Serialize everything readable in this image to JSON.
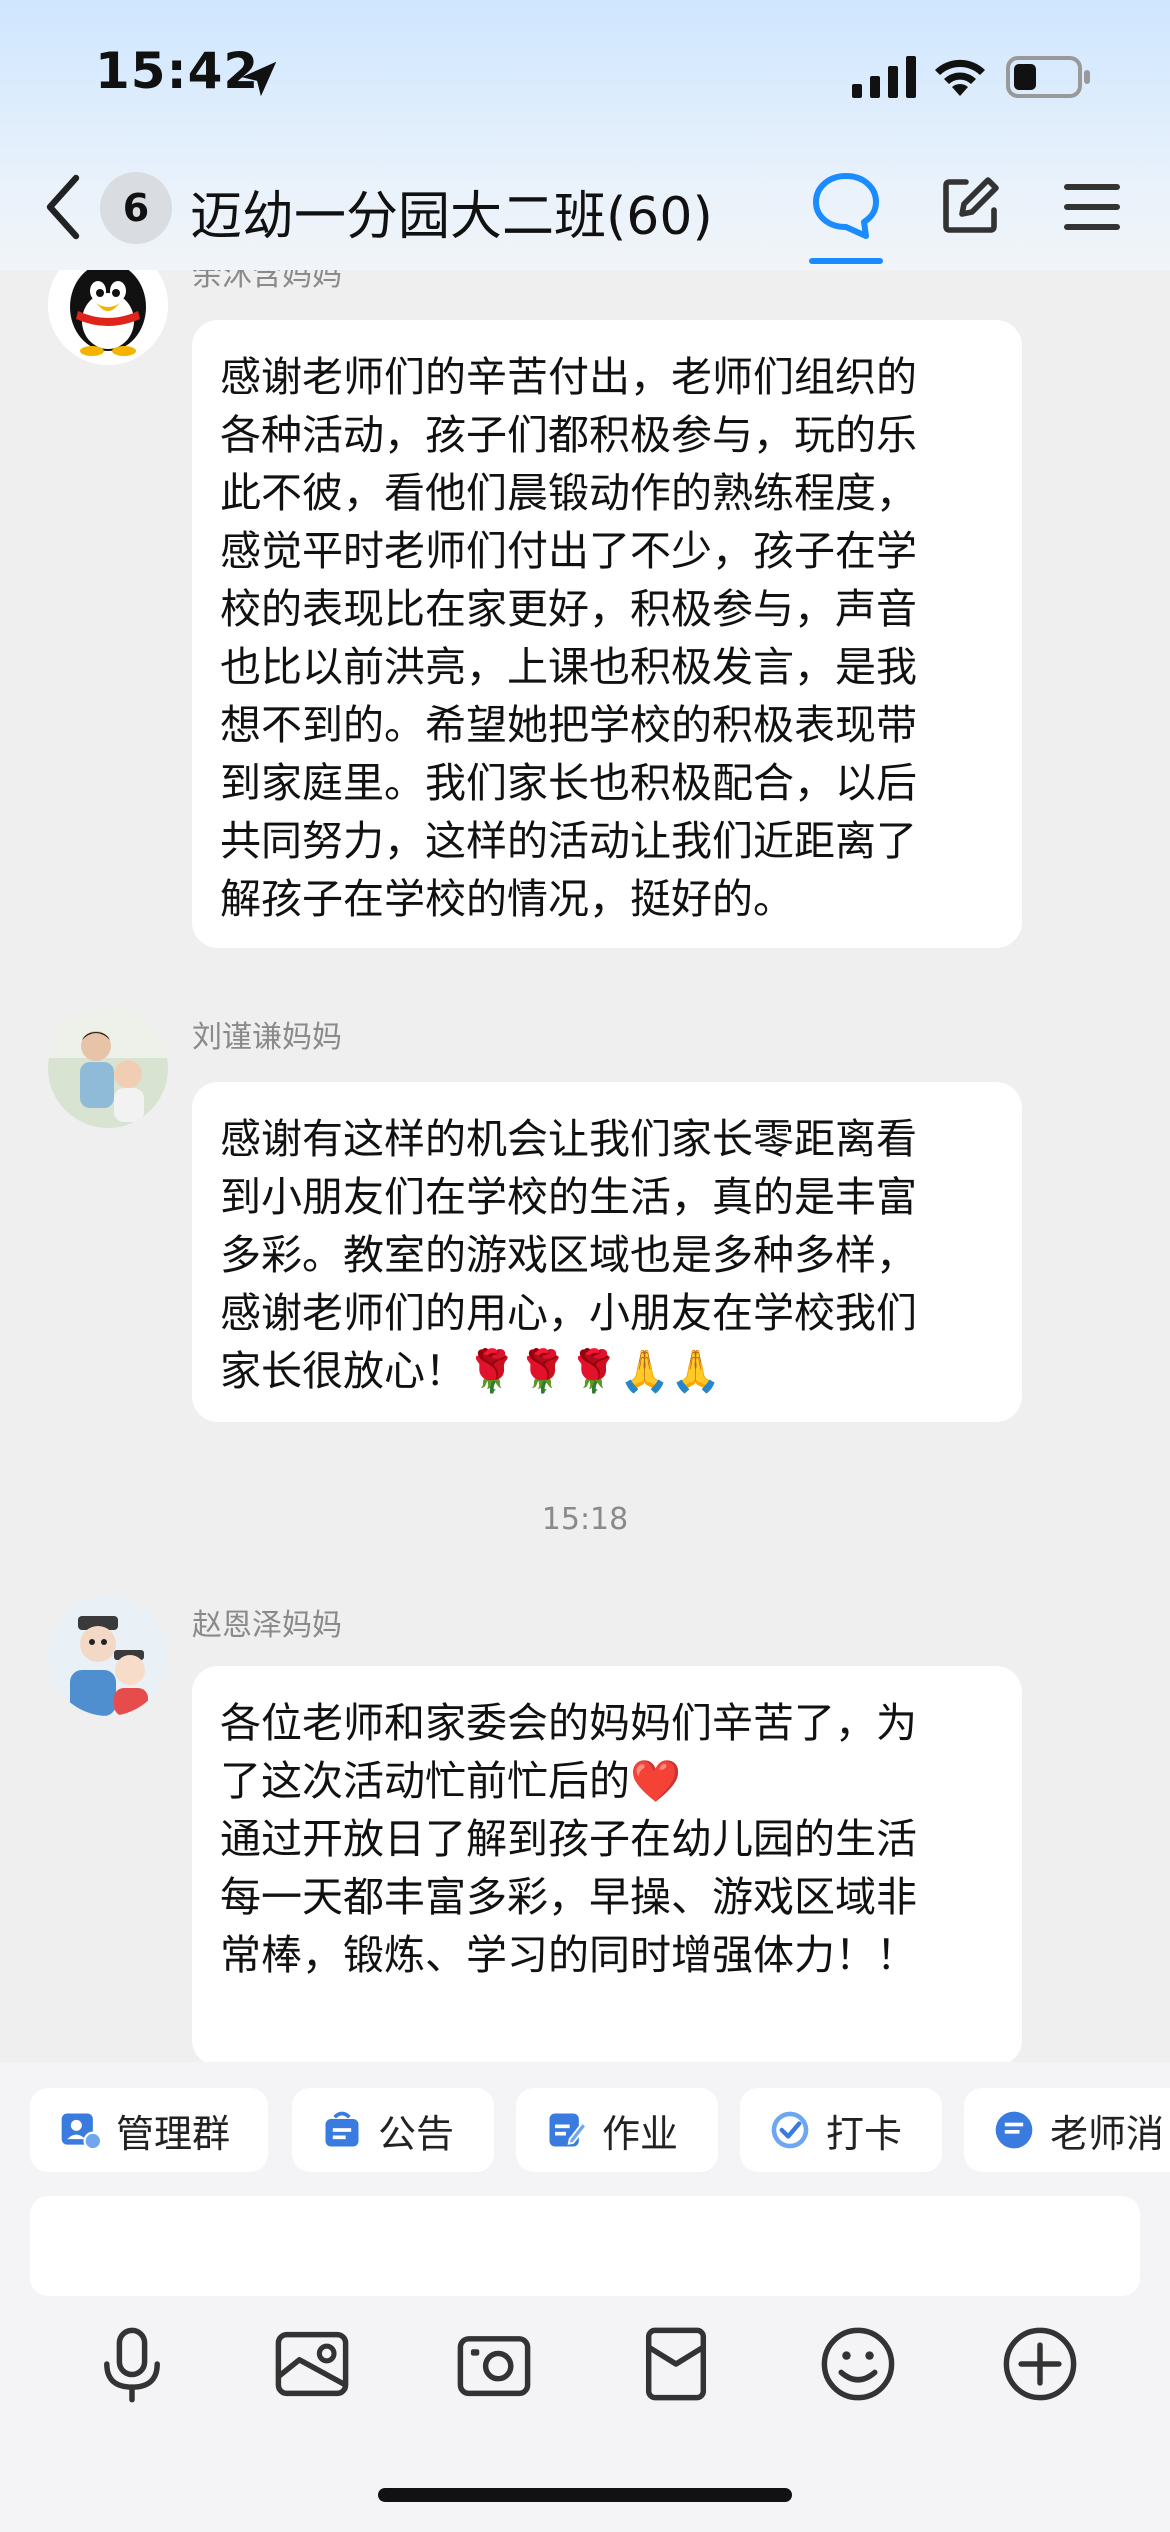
{
  "status_bar": {
    "time": "15:42"
  },
  "nav": {
    "badge": "6",
    "title": "迈幼一分园大二班(60)"
  },
  "messages": [
    {
      "sender": "余沐含妈妈",
      "text": "感谢老师们的辛苦付出，老师们组织的\n各种活动，孩子们都积极参与，玩的乐\n此不彼，看他们晨锻动作的熟练程度，\n感觉平时老师们付出了不少，孩子在学\n校的表现比在家更好，积极参与，声音\n也比以前洪亮，上课也积极发言，是我\n想不到的。希望她把学校的积极表现带\n到家庭里。我们家长也积极配合，以后\n共同努力，这样的活动让我们近距离了\n解孩子在学校的情况，挺好的。"
    },
    {
      "sender": "刘谨谦妈妈",
      "text": "感谢有这样的机会让我们家长零距离看\n到小朋友们在学校的生活，真的是丰富\n多彩。教室的游戏区域也是多种多样，\n感谢老师们的用心，小朋友在学校我们\n家长很放心！🌹🌹🌹🙏🙏"
    },
    {
      "sender": "赵恩泽妈妈",
      "text": "各位老师和家委会的妈妈们辛苦了，为\n了这次活动忙前忙后的❤️\n通过开放日了解到孩子在幼儿园的生活\n每一天都丰富多彩，早操、游戏区域非\n常棒，锻炼、学习的同时增强体力！！"
    }
  ],
  "timestamp": "15:18",
  "quick_actions": [
    {
      "label": "管理群",
      "icon": "manage-group-icon"
    },
    {
      "label": "公告",
      "icon": "announcement-icon"
    },
    {
      "label": "作业",
      "icon": "homework-icon"
    },
    {
      "label": "打卡",
      "icon": "checkin-icon"
    },
    {
      "label": "老师消",
      "icon": "teacher-message-icon"
    }
  ],
  "toolbar_icons": [
    "microphone-icon",
    "image-icon",
    "camera-icon",
    "red-packet-icon",
    "emoji-icon",
    "plus-icon"
  ],
  "colors": {
    "accent": "#1a8cff",
    "chat_bg": "#efefef",
    "bubble": "#ffffff"
  }
}
